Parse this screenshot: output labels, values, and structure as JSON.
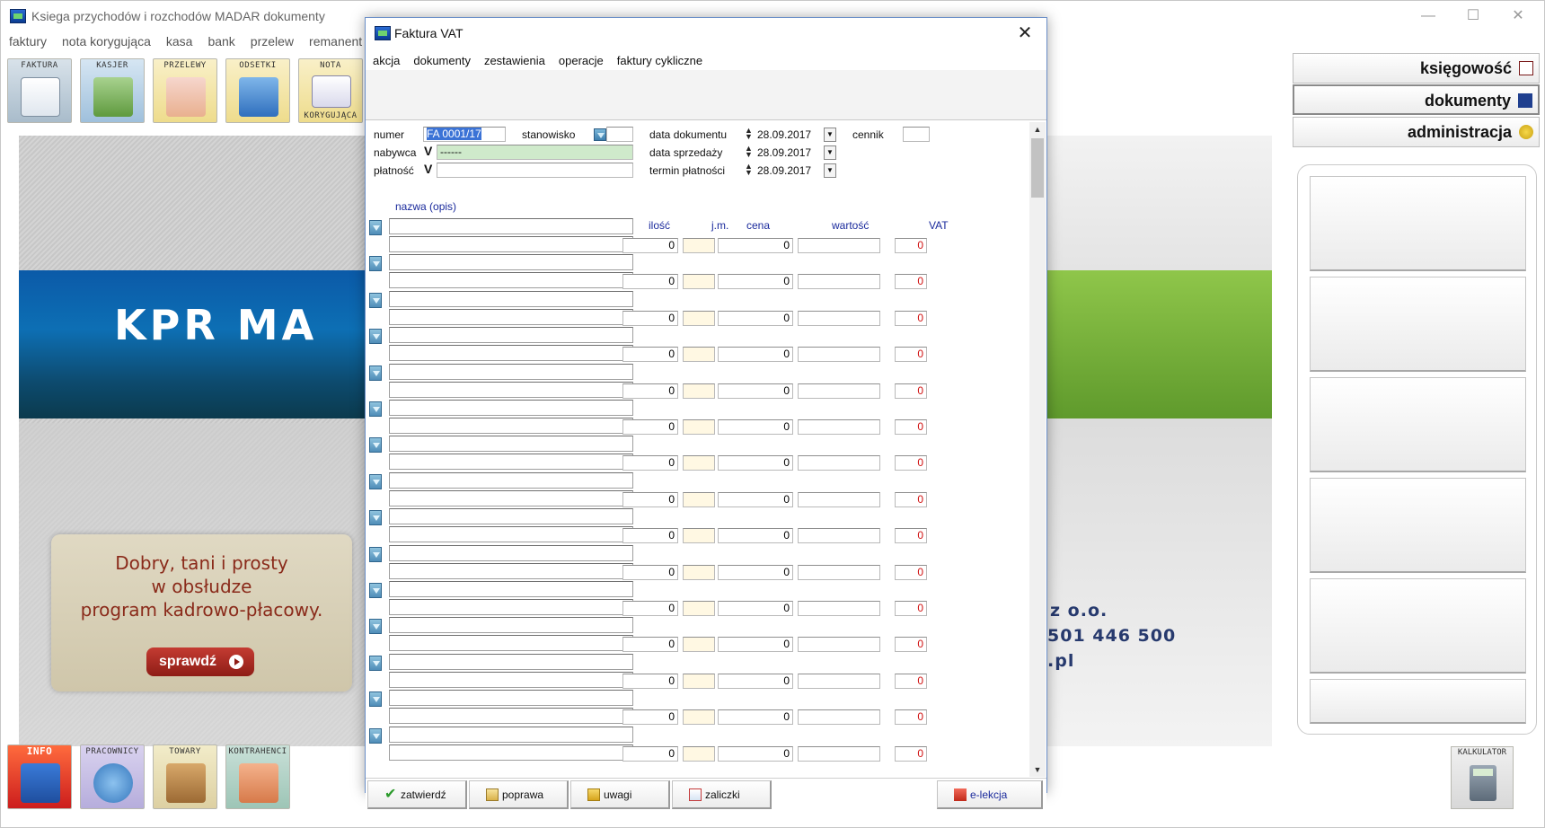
{
  "app": {
    "title": "Ksiega przychodów i rozchodów MADAR  dokumenty",
    "window_controls": {
      "minimize": "—",
      "maximize": "☐",
      "close": "✕"
    }
  },
  "main_menu": [
    "faktury",
    "nota korygująca",
    "kasa",
    "bank",
    "przelew",
    "remanent"
  ],
  "toolbar": [
    {
      "id": "faktura",
      "label": "FAKTURA",
      "icon": "invoice-icon"
    },
    {
      "id": "kasjer",
      "label": "KASJER",
      "icon": "cash-register-icon"
    },
    {
      "id": "przelewy",
      "label": "PRZELEWY",
      "icon": "transfer-icon"
    },
    {
      "id": "odsetki",
      "label": "ODSETKI",
      "icon": "percent-icon"
    },
    {
      "id": "nota",
      "label": "NOTA",
      "label2": "KORYGUJĄCA",
      "icon": "envelope-icon"
    }
  ],
  "bottom_toolbar": [
    {
      "id": "info",
      "label": "INFO",
      "icon": "info-chart-icon"
    },
    {
      "id": "pracownicy",
      "label": "PRACOWNICY",
      "icon": "person-icon"
    },
    {
      "id": "towary",
      "label": "TOWARY",
      "icon": "box-icon"
    },
    {
      "id": "kontrahenci",
      "label": "KONTRAHENCI",
      "icon": "handshake-icon"
    }
  ],
  "background": {
    "brand_text": "KPR MA",
    "ad_lines": [
      "Dobry, tani i prosty",
      "w obsłudze",
      "program kadrowo-płacowy."
    ],
    "ad_button": "sprawdź",
    "company_suffix": "z o.o.",
    "phone_fragment": "501 446 500",
    "domain_fragment": ".pl"
  },
  "side_nav": [
    {
      "label": "księgowość",
      "icon": "ledger-icon"
    },
    {
      "label": "dokumenty",
      "icon": "documents-icon"
    },
    {
      "label": "administracja",
      "icon": "keys-icon"
    }
  ],
  "calculator": {
    "label": "KALKULATOR",
    "icon": "calculator-icon"
  },
  "dialog": {
    "title": "Faktura VAT",
    "close": "✕",
    "menu": [
      "akcja",
      "dokumenty",
      "zestawienia",
      "operacje",
      "faktury cykliczne"
    ],
    "header": {
      "numer_label": "numer",
      "numer_value": "FA 0001/17",
      "stanowisko_label": "stanowisko",
      "nabywca_label": "nabywca",
      "nabywca_value": "------",
      "platnosc_label": "płatność",
      "data_dokumentu_label": "data dokumentu",
      "data_dokumentu_value": "28.09.2017",
      "data_sprzedazy_label": "data sprzedaży",
      "data_sprzedazy_value": "28.09.2017",
      "termin_platnosci_label": "termin płatności",
      "termin_platnosci_value": "28.09.2017",
      "cennik_label": "cennik",
      "check_mark": "V"
    },
    "columns": {
      "nazwa": "nazwa  (opis)",
      "ilosc": "ilość",
      "jm": "j.m.",
      "cena": "cena",
      "wartosc": "wartość",
      "vat": "VAT"
    },
    "rows": [
      {
        "ilosc": "0",
        "cena": "0",
        "vat": "0"
      },
      {
        "ilosc": "0",
        "cena": "0",
        "vat": "0"
      },
      {
        "ilosc": "0",
        "cena": "0",
        "vat": "0"
      },
      {
        "ilosc": "0",
        "cena": "0",
        "vat": "0"
      },
      {
        "ilosc": "0",
        "cena": "0",
        "vat": "0"
      },
      {
        "ilosc": "0",
        "cena": "0",
        "vat": "0"
      },
      {
        "ilosc": "0",
        "cena": "0",
        "vat": "0"
      },
      {
        "ilosc": "0",
        "cena": "0",
        "vat": "0"
      },
      {
        "ilosc": "0",
        "cena": "0",
        "vat": "0"
      },
      {
        "ilosc": "0",
        "cena": "0",
        "vat": "0"
      },
      {
        "ilosc": "0",
        "cena": "0",
        "vat": "0"
      },
      {
        "ilosc": "0",
        "cena": "0",
        "vat": "0"
      },
      {
        "ilosc": "0",
        "cena": "0",
        "vat": "0"
      },
      {
        "ilosc": "0",
        "cena": "0",
        "vat": "0"
      },
      {
        "ilosc": "0",
        "cena": "0",
        "vat": "0"
      }
    ],
    "buttons": {
      "zatwierdz": "zatwierdź",
      "poprawa": "poprawa",
      "uwagi": "uwagi",
      "zaliczki": "zaliczki",
      "elekcja": "e-lekcja"
    }
  },
  "colors": {
    "selection": "#3b73d6",
    "vat_red": "#d01010",
    "label_blue": "#1a2a9c",
    "buyer_green": "#cfeacb"
  }
}
